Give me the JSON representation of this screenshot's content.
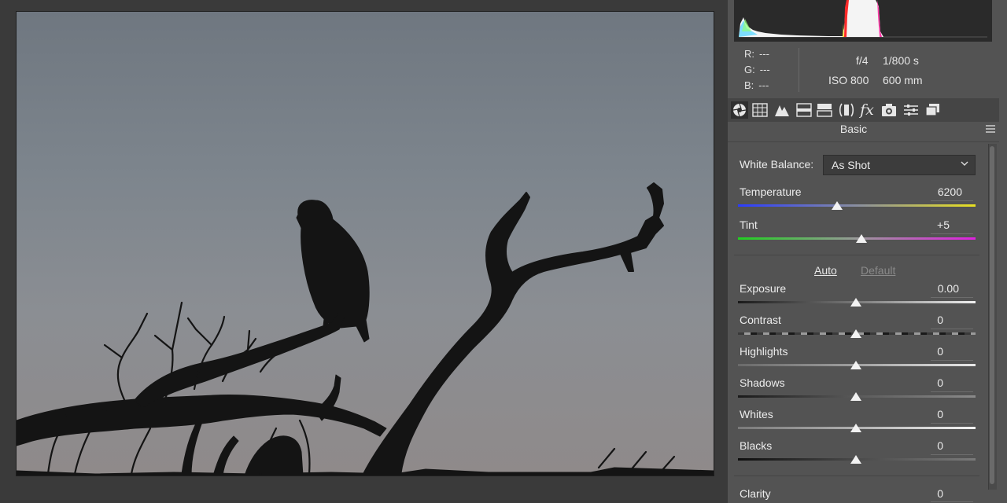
{
  "info": {
    "r_label": "R:",
    "r_value": "---",
    "g_label": "G:",
    "g_value": "---",
    "b_label": "B:",
    "b_value": "---",
    "aperture": "f/4",
    "shutter": "1/800 s",
    "iso": "ISO 800",
    "focal_length": "600 mm"
  },
  "toolbar": {
    "icons": [
      "basic-aperture-icon",
      "tone-curve-icon",
      "detail-icon",
      "hsl-icon",
      "split-toning-icon",
      "lens-corrections-icon",
      "effects-icon",
      "camera-calibration-icon",
      "presets-icon",
      "snapshots-icon"
    ],
    "effects_label": "fx"
  },
  "panel": {
    "title": "Basic",
    "white_balance_label": "White Balance:",
    "white_balance_value": "As Shot",
    "auto_label": "Auto",
    "default_label": "Default"
  },
  "sliders": {
    "temperature": {
      "label": "Temperature",
      "value": "6200"
    },
    "tint": {
      "label": "Tint",
      "value": "+5"
    },
    "exposure": {
      "label": "Exposure",
      "value": "0.00"
    },
    "contrast": {
      "label": "Contrast",
      "value": "0"
    },
    "highlights": {
      "label": "Highlights",
      "value": "0"
    },
    "shadows": {
      "label": "Shadows",
      "value": "0"
    },
    "whites": {
      "label": "Whites",
      "value": "0"
    },
    "blacks": {
      "label": "Blacks",
      "value": "0"
    },
    "clarity": {
      "label": "Clarity",
      "value": "0"
    }
  },
  "colors": {
    "panel_bg": "#535353",
    "link_active": "#e6e6e6",
    "link_disabled": "#8a8a8a"
  }
}
